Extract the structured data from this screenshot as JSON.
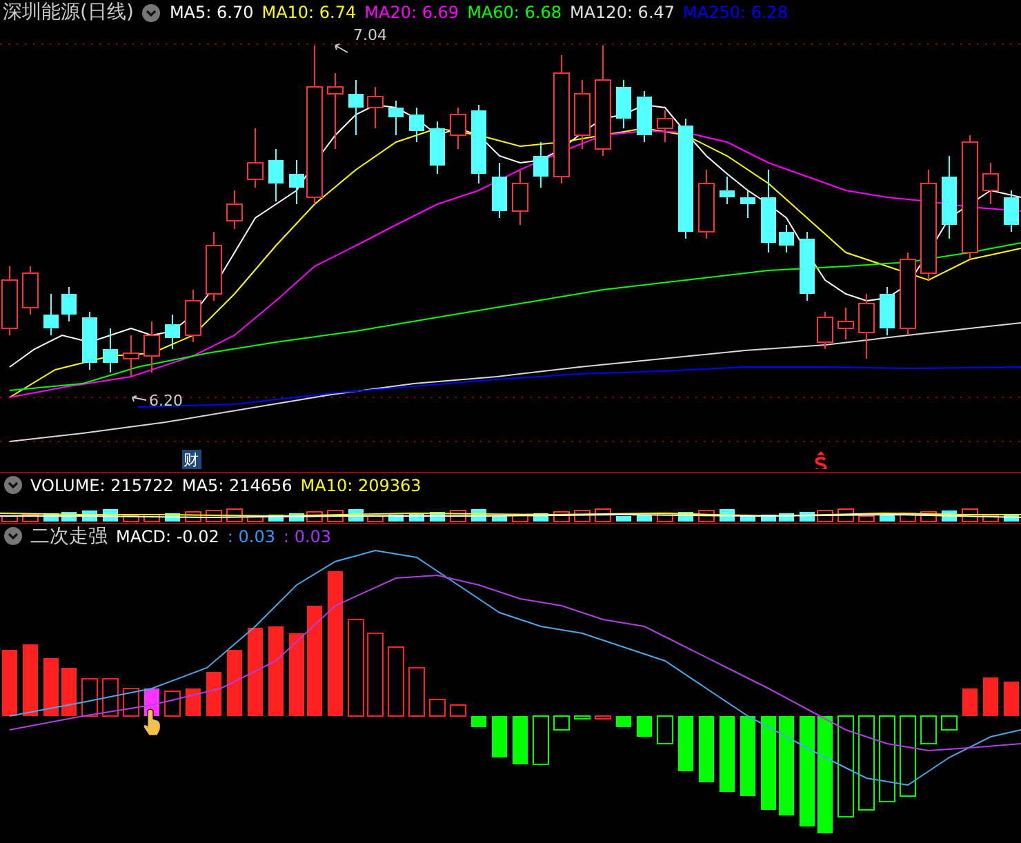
{
  "main_legend": {
    "title": "深圳能源(日线)",
    "items": [
      {
        "text": "MA5: 6.70",
        "color": "#ffffff"
      },
      {
        "text": "MA10: 6.74",
        "color": "#ffff00"
      },
      {
        "text": "MA20: 6.69",
        "color": "#ff00ff"
      },
      {
        "text": "MA60: 6.68",
        "color": "#00ff00"
      },
      {
        "text": "MA120: 6.47",
        "color": "#e0e0e0"
      },
      {
        "text": "MA250: 6.28",
        "color": "#0000ff"
      }
    ]
  },
  "price_labels": {
    "high": "7.04",
    "low": "6.20"
  },
  "markers": [
    {
      "kind": "badge",
      "text": "财"
    },
    {
      "kind": "dollar"
    }
  ],
  "volume_legend": {
    "items": [
      {
        "text": "VOLUME: 215722",
        "color": "#ffffff"
      },
      {
        "text": "MA5: 214656",
        "color": "#ffffff"
      },
      {
        "text": "MA10: 209363",
        "color": "#ffff00"
      }
    ]
  },
  "macd_legend": {
    "title": "二次走强",
    "items": [
      {
        "text": "MACD: -0.02",
        "color": "#ffffff"
      },
      {
        "text": ": 0.03",
        "color": "#3399ff"
      },
      {
        "text": ": 0.03",
        "color": "#aa33ff"
      }
    ]
  }
}
